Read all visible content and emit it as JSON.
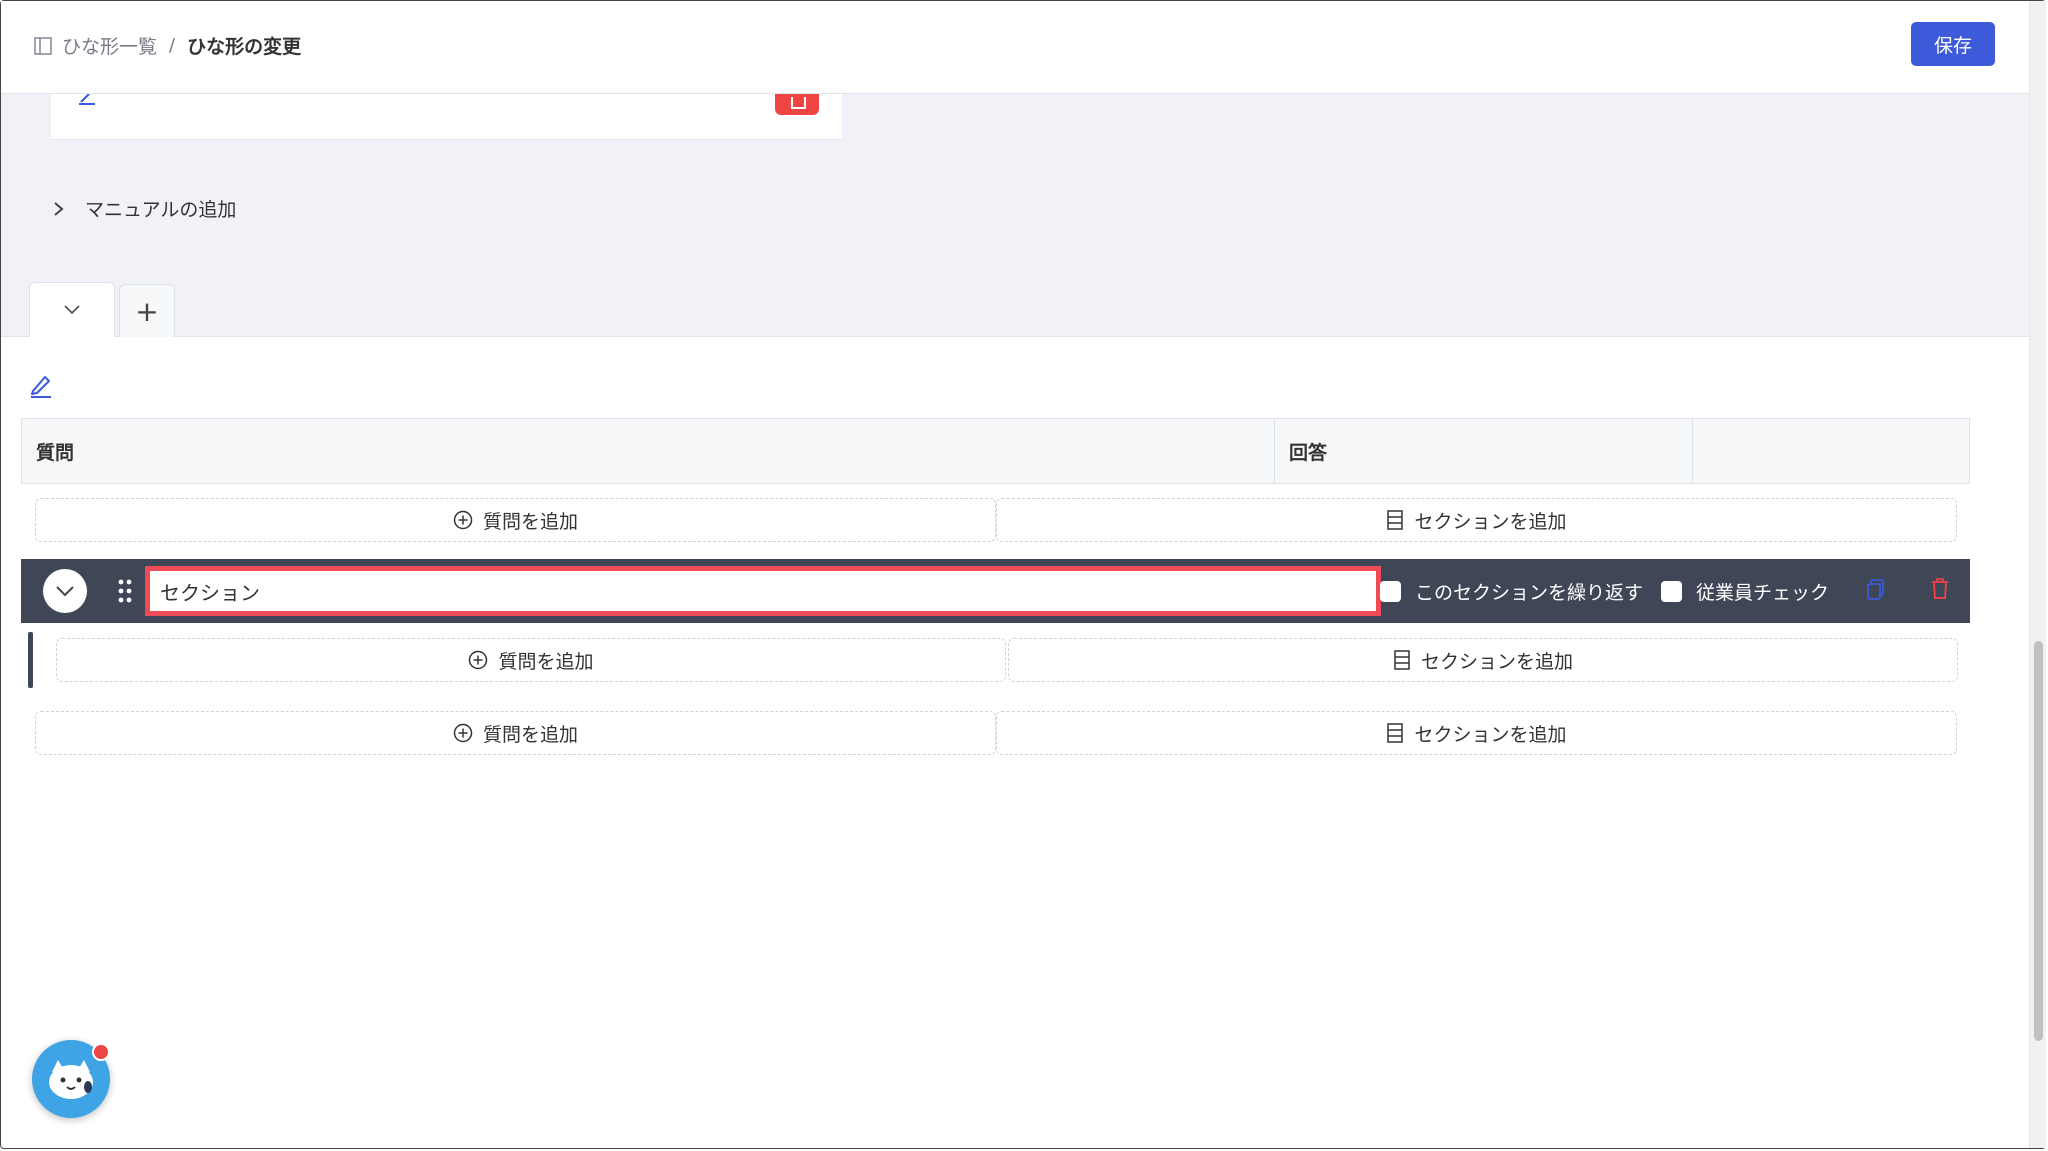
{
  "breadcrumb": {
    "parent": "ひな形一覧",
    "separator": "/",
    "current": "ひな形の変更"
  },
  "header": {
    "save_label": "保存"
  },
  "manual": {
    "label": "マニュアルの追加"
  },
  "tabs": {
    "add_symbol": "+"
  },
  "table": {
    "col_question": "質問",
    "col_answer": "回答",
    "col_extra": ""
  },
  "add": {
    "question_label": "質問を追加",
    "section_label": "セクションを追加"
  },
  "section": {
    "title_value": "セクション",
    "repeat_label": "このセクションを繰り返す",
    "employee_check_label": "従業員チェック"
  },
  "colors": {
    "primary": "#3d5adb",
    "danger": "#ef4444",
    "section_bg": "#3f4656",
    "highlight": "#ef4a55"
  }
}
